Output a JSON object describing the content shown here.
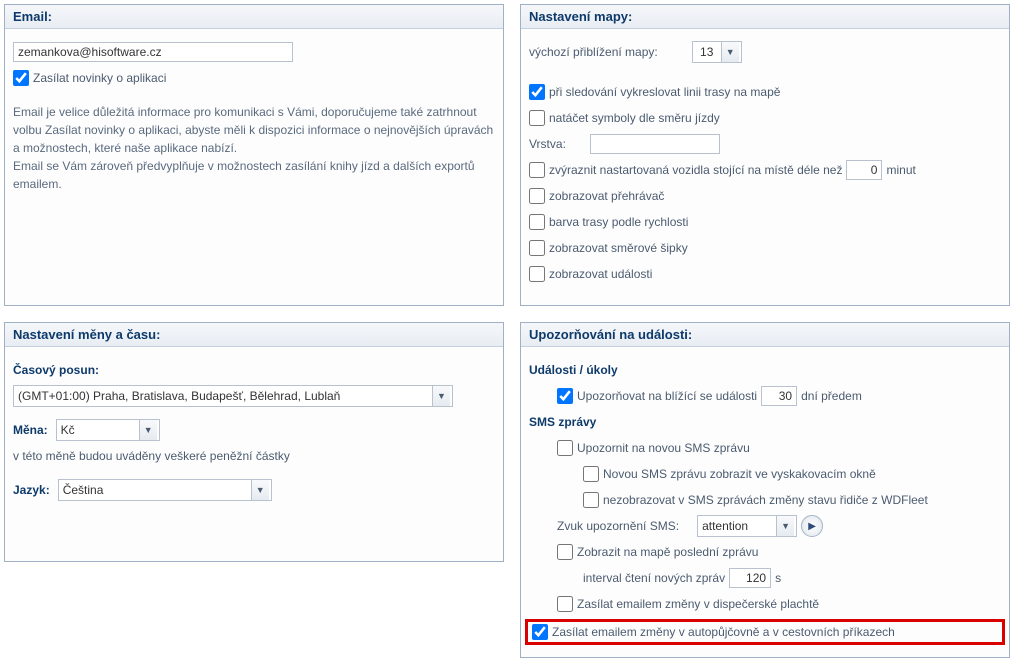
{
  "email": {
    "header": "Email:",
    "value": "zemankova@hisoftware.cz",
    "newsletter_label": "Zasílat novinky o aplikaci",
    "description": "Email je velice důležitá informace pro komunikaci s Vámi, doporučujeme také zatrhnout volbu Zasílat novinky o aplikaci, abyste měli k dispozici informace o nejnovějších úpravách a možnostech, které naše aplikace nabízí.\nEmail se Vám zároveň předvyplňuje v možnostech zasílání knihy jízd a dalších exportů emailem."
  },
  "currency_time": {
    "header": "Nastavení měny a času:",
    "timeshift_label": "Časový posun:",
    "timeshift_value": "(GMT+01:00) Praha, Bratislava, Budapešť, Bělehrad, Lublaň",
    "currency_label": "Měna:",
    "currency_value": "Kč",
    "currency_note": "v této měně budou uváděny veškeré peněžní částky",
    "language_label": "Jazyk:",
    "language_value": "Čeština"
  },
  "map": {
    "header": "Nastavení mapy:",
    "zoom_label": "výchozí přiblížení mapy:",
    "zoom_value": "13",
    "track_line_label": "při sledování vykreslovat linii trasy na mapě",
    "rotate_symbols_label": "natáčet symboly dle směru jízdy",
    "layer_label": "Vrstva:",
    "highlight_stopped_label_pre": "zvýraznit nastartovaná vozidla stojící na místě déle než",
    "highlight_stopped_value": "0",
    "highlight_stopped_label_post": "minut",
    "player_label": "zobrazovat přehrávač",
    "speed_color_label": "barva trasy podle rychlosti",
    "arrows_label": "zobrazovat směrové šipky",
    "events_label": "zobrazovat události"
  },
  "alerts": {
    "header": "Upozorňování na události:",
    "events_tasks_heading": "Události / úkoly",
    "upcoming_label_pre": "Upozorňovat na blížící se události",
    "upcoming_value": "30",
    "upcoming_label_post": "dní předem",
    "sms_heading": "SMS zprávy",
    "new_sms_label": "Upozornit na novou SMS zprávu",
    "popup_sms_label": "Novou SMS zprávu zobrazit ve vyskakovacím okně",
    "wdfleet_label": "nezobrazovat v SMS zprávách změny stavu řidiče z WDFleet",
    "sound_label": "Zvuk upozornění SMS:",
    "sound_value": "attention",
    "show_last_label": "Zobrazit na mapě poslední zprávu",
    "interval_label": "interval čtení nových zpráv",
    "interval_value": "120",
    "interval_unit": "s",
    "dispatch_label": "Zasílat emailem změny v dispečerské plachtě",
    "rental_label": "Zasílat emailem změny v autopůjčovně a v cestovních příkazech"
  }
}
